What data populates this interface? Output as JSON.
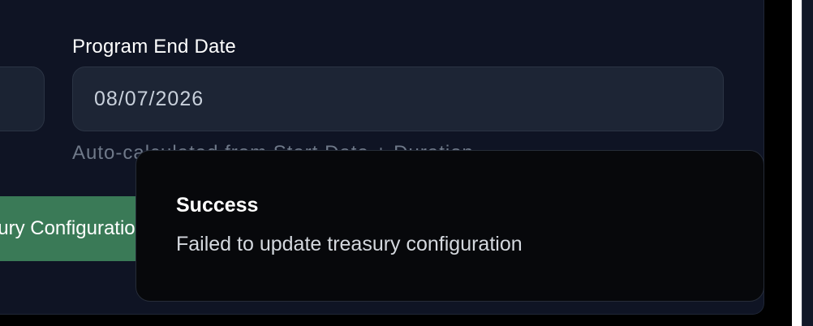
{
  "form": {
    "end_date_label": "Program End Date",
    "end_date_value": "08/07/2026",
    "end_date_hint": "Auto-calculated from Start Date + Duration",
    "save_button_label": "Save Treasury Configuration"
  },
  "toast": {
    "title": "Success",
    "message": "Failed to update treasury configuration"
  },
  "colors": {
    "card_background": "#0f1424",
    "input_background": "#1d2535",
    "button_green": "#3a7a57",
    "toast_background": "#07080b"
  }
}
